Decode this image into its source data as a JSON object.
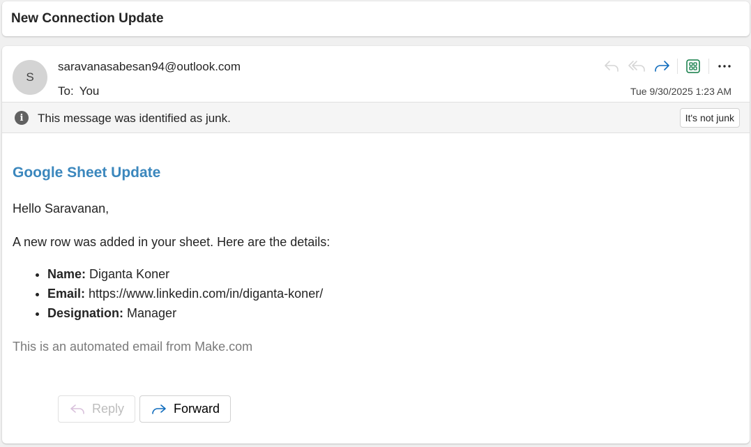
{
  "subject": "New Connection Update",
  "message": {
    "avatar_initial": "S",
    "sender": "saravanasabesan94@outlook.com",
    "to_label": "To:",
    "to_value": "You",
    "timestamp": "Tue 9/30/2025 1:23 AM"
  },
  "toolbar": {
    "icons": [
      "reply-icon",
      "reply-all-icon",
      "forward-icon",
      "apps-icon",
      "more-options-icon"
    ],
    "more_label": "···"
  },
  "junk_banner": {
    "text": "This message was identified as junk.",
    "button": "It's not junk"
  },
  "body": {
    "heading": "Google Sheet Update",
    "greeting": "Hello Saravanan,",
    "intro": "A new row was added in your sheet. Here are the details:",
    "details": [
      {
        "key": "Name:",
        "value": "Diganta Koner"
      },
      {
        "key": "Email:",
        "value": "https://www.linkedin.com/in/diganta-koner/"
      },
      {
        "key": "Designation:",
        "value": "Manager"
      }
    ],
    "footer": "This is an automated email from Make.com"
  },
  "actions": {
    "reply": "Reply",
    "forward": "Forward"
  },
  "colors": {
    "heading": "#3b87bd",
    "forward_icon": "#0f6cbd",
    "apps_icon": "#0e7a44",
    "disabled": "#c8c8c8"
  }
}
